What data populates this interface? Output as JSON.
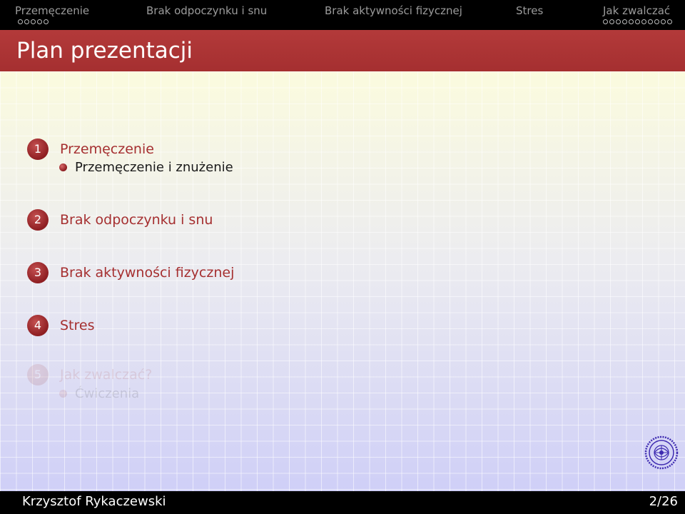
{
  "nav": {
    "sections": [
      {
        "label": "Przemęczenie",
        "dots": 5
      },
      {
        "label": "Brak odpoczynku i snu"
      },
      {
        "label": "Brak aktywności fizycznej"
      },
      {
        "label": "Stres"
      },
      {
        "label": "Jak zwalczać",
        "dots": 11
      }
    ]
  },
  "frame": {
    "title": "Plan prezentacji"
  },
  "toc": [
    {
      "number": "1",
      "title": "Przemęczenie",
      "sub": "Przemęczenie i znużenie"
    },
    {
      "number": "2",
      "title": "Brak odpoczynku i snu"
    },
    {
      "number": "3",
      "title": "Brak aktywności fizycznej"
    },
    {
      "number": "4",
      "title": "Stres"
    },
    {
      "number": "5",
      "title": "Jak zwalczać?",
      "sub": "Ćwiczenia"
    }
  ],
  "footer": {
    "author": "Krzysztof Rykaczewski",
    "page": "2/26"
  },
  "colors": {
    "accent": "#a52f30",
    "bar": "#000000"
  }
}
